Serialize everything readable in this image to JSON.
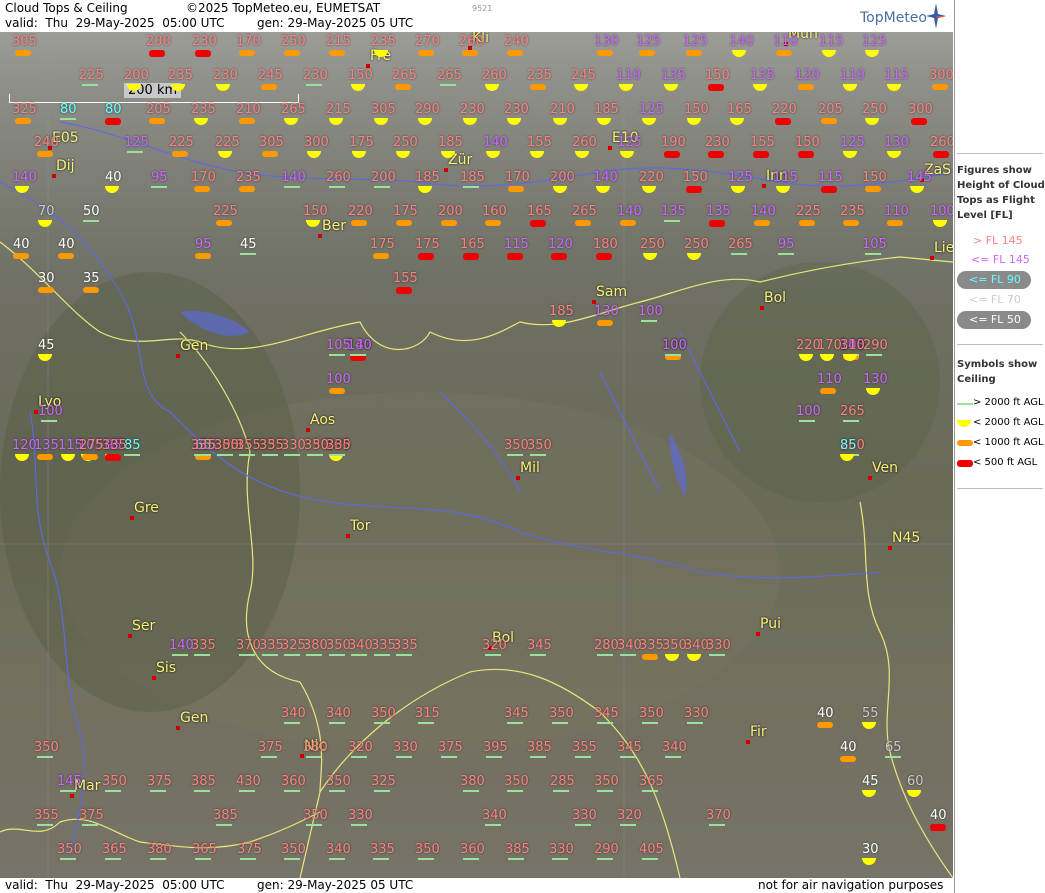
{
  "header": {
    "title": "Cloud Tops & Ceiling",
    "valid": "valid:  Thu  29-May-2025  05:00 UTC",
    "copyright": "©2025 TopMeteo.eu, EUMETSAT",
    "generated": "gen: 29-May-2025 05 UTC",
    "small_id": "9521",
    "logo": "TopMeteo"
  },
  "footer": {
    "valid": "valid:  Thu  29-May-2025  05:00 UTC",
    "generated": "gen: 29-May-2025 05 UTC",
    "note": "not for air navigation purposes"
  },
  "scale": {
    "label": "200 km"
  },
  "legend": {
    "figures_title": "Figures show Height of Cloud Tops as Flight Level [FL]",
    "levels": [
      {
        "label": "> FL 145",
        "color": "#ff8080"
      },
      {
        "label": "<= FL 145",
        "color": "#cc66ff"
      },
      {
        "label": "<= FL 90",
        "color": "#66ffff"
      },
      {
        "label": "<= FL 70",
        "color": "#cccccc"
      },
      {
        "label": "<= FL 50",
        "color": "#ffffff"
      }
    ],
    "symbols_title": "Symbols show Ceiling",
    "symbols": [
      {
        "label": "> 2000 ft AGL",
        "kind": "green-line"
      },
      {
        "label": "< 2000 ft AGL",
        "kind": "yellow-half"
      },
      {
        "label": "< 1000 ft AGL",
        "kind": "orange-pill"
      },
      {
        "label": "< 500 ft AGL",
        "kind": "red-pill"
      }
    ]
  },
  "cities": [
    "Fre",
    "Mun",
    "Kli",
    "Dij",
    "Zür",
    "Inn",
    "Ber",
    "Lie",
    "Sam",
    "Bol",
    "Gen",
    "Lyo",
    "Aos",
    "Mil",
    "Ven",
    "Gre",
    "Tor",
    "Ser",
    "Sis",
    "Gen",
    "Bol",
    "Pui",
    "Nic",
    "Fir",
    "Mar",
    "E05",
    "E10",
    "N45",
    "ZaS"
  ],
  "colors": {
    "high": "#ff8080",
    "mid": "#cc66ff",
    "fl90": "#66ffff",
    "fl70": "#cccccc",
    "fl50": "#ffffff",
    "city": "#f8f27a"
  },
  "stations": [
    [
      "305",
      "high",
      "orange"
    ],
    [
      "200",
      "high",
      "red"
    ],
    [
      "230",
      "high",
      "red"
    ],
    [
      "170",
      "high",
      "orange"
    ],
    [
      "250",
      "high",
      "orange"
    ],
    [
      "215",
      "high",
      "orange"
    ],
    [
      "235",
      "high",
      "yellow"
    ],
    [
      "270",
      "high",
      "orange"
    ],
    [
      "260",
      "high",
      "orange"
    ],
    [
      "240",
      "high",
      "orange"
    ],
    [
      "130",
      "mid",
      "orange"
    ],
    [
      "125",
      "mid",
      "orange"
    ],
    [
      "125",
      "mid",
      "orange"
    ],
    [
      "140",
      "mid",
      "yellow"
    ],
    [
      "110",
      "mid",
      "orange"
    ],
    [
      "115",
      "mid",
      "yellow"
    ],
    [
      "125",
      "mid",
      "yellow"
    ],
    [
      "225",
      "high",
      "green"
    ],
    [
      "200",
      "high",
      "yellow"
    ],
    [
      "235",
      "high",
      "yellow"
    ],
    [
      "230",
      "high",
      "yellow"
    ],
    [
      "245",
      "high",
      "orange"
    ],
    [
      "230",
      "high",
      "green"
    ],
    [
      "150",
      "high",
      "yellow"
    ],
    [
      "265",
      "high",
      "orange"
    ],
    [
      "265",
      "high",
      "green"
    ],
    [
      "260",
      "high",
      "yellow"
    ],
    [
      "235",
      "high",
      "orange"
    ],
    [
      "245",
      "high",
      "yellow"
    ],
    [
      "110",
      "mid",
      "yellow"
    ],
    [
      "135",
      "mid",
      "yellow"
    ],
    [
      "150",
      "high",
      "red"
    ],
    [
      "135",
      "mid",
      "yellow"
    ],
    [
      "120",
      "mid",
      "orange"
    ],
    [
      "110",
      "mid",
      "yellow"
    ],
    [
      "115",
      "mid",
      "yellow"
    ],
    [
      "300",
      "high",
      "orange"
    ],
    [
      "325",
      "high",
      "orange"
    ],
    [
      "80",
      "fl90",
      "green"
    ],
    [
      "80",
      "fl90",
      "red"
    ],
    [
      "205",
      "high",
      "orange"
    ],
    [
      "235",
      "high",
      "yellow"
    ],
    [
      "210",
      "high",
      "orange"
    ],
    [
      "265",
      "high",
      "yellow"
    ],
    [
      "215",
      "high",
      "yellow"
    ],
    [
      "305",
      "high",
      "yellow"
    ],
    [
      "290",
      "high",
      "yellow"
    ],
    [
      "230",
      "high",
      "yellow"
    ],
    [
      "230",
      "high",
      "yellow"
    ],
    [
      "210",
      "high",
      "yellow"
    ],
    [
      "185",
      "high",
      "yellow"
    ],
    [
      "125",
      "mid",
      "yellow"
    ],
    [
      "150",
      "high",
      "yellow"
    ],
    [
      "165",
      "high",
      "yellow"
    ],
    [
      "220",
      "high",
      "red"
    ],
    [
      "205",
      "high",
      "orange"
    ],
    [
      "250",
      "high",
      "yellow"
    ],
    [
      "300",
      "high",
      "red"
    ],
    [
      "240",
      "high",
      "orange"
    ],
    [
      "125",
      "mid",
      "green"
    ],
    [
      "225",
      "high",
      "orange"
    ],
    [
      "225",
      "high",
      "yellow"
    ],
    [
      "305",
      "high",
      "orange"
    ],
    [
      "300",
      "high",
      "yellow"
    ],
    [
      "175",
      "high",
      "yellow"
    ],
    [
      "250",
      "high",
      "yellow"
    ],
    [
      "185",
      "high",
      "yellow"
    ],
    [
      "140",
      "mid",
      "yellow"
    ],
    [
      "155",
      "high",
      "yellow"
    ],
    [
      "260",
      "high",
      "yellow"
    ],
    [
      "125",
      "mid",
      "yellow"
    ],
    [
      "190",
      "high",
      "red"
    ],
    [
      "230",
      "high",
      "red"
    ],
    [
      "155",
      "high",
      "red"
    ],
    [
      "150",
      "high",
      "red"
    ],
    [
      "125",
      "mid",
      "yellow"
    ],
    [
      "130",
      "mid",
      "yellow"
    ],
    [
      "260",
      "high",
      "red"
    ],
    [
      "140",
      "mid",
      "yellow"
    ],
    [
      "40",
      "fl50",
      "yellow"
    ],
    [
      "95",
      "mid",
      "green"
    ],
    [
      "170",
      "high",
      "orange"
    ],
    [
      "235",
      "high",
      "orange"
    ],
    [
      "140",
      "mid",
      "green"
    ],
    [
      "260",
      "high",
      "green"
    ],
    [
      "200",
      "high",
      "green"
    ],
    [
      "185",
      "high",
      "yellow"
    ],
    [
      "185",
      "high",
      "green"
    ],
    [
      "170",
      "high",
      "orange"
    ],
    [
      "200",
      "high",
      "yellow"
    ],
    [
      "140",
      "mid",
      "yellow"
    ],
    [
      "220",
      "high",
      "yellow"
    ],
    [
      "150",
      "high",
      "red"
    ],
    [
      "125",
      "mid",
      "yellow"
    ],
    [
      "115",
      "mid",
      "yellow"
    ],
    [
      "115",
      "mid",
      "red"
    ],
    [
      "150",
      "high",
      "orange"
    ],
    [
      "145",
      "mid",
      "yellow"
    ],
    [
      "70",
      "fl70",
      "yellow"
    ],
    [
      "50",
      "fl50",
      "green"
    ],
    [
      "225",
      "high",
      "orange"
    ],
    [
      "150",
      "high",
      "yellow"
    ],
    [
      "220",
      "high",
      "orange"
    ],
    [
      "175",
      "high",
      "orange"
    ],
    [
      "200",
      "high",
      "orange"
    ],
    [
      "160",
      "high",
      "orange"
    ],
    [
      "165",
      "high",
      "red"
    ],
    [
      "265",
      "high",
      "orange"
    ],
    [
      "140",
      "mid",
      "orange"
    ],
    [
      "135",
      "mid",
      "green"
    ],
    [
      "135",
      "mid",
      "red"
    ],
    [
      "140",
      "mid",
      "orange"
    ],
    [
      "225",
      "high",
      "orange"
    ],
    [
      "235",
      "high",
      "orange"
    ],
    [
      "110",
      "mid",
      "orange"
    ],
    [
      "100",
      "mid",
      "yellow"
    ],
    [
      "40",
      "fl50",
      "orange"
    ],
    [
      "40",
      "fl50",
      "orange"
    ],
    [
      "95",
      "mid",
      "orange"
    ],
    [
      "45",
      "fl50",
      "green"
    ],
    [
      "175",
      "high",
      "orange"
    ],
    [
      "175",
      "high",
      "red"
    ],
    [
      "165",
      "high",
      "red"
    ],
    [
      "115",
      "mid",
      "red"
    ],
    [
      "120",
      "mid",
      "red"
    ],
    [
      "180",
      "high",
      "red"
    ],
    [
      "250",
      "high",
      "yellow"
    ],
    [
      "250",
      "high",
      "yellow"
    ],
    [
      "265",
      "high",
      "green"
    ],
    [
      "95",
      "mid",
      "green"
    ],
    [
      "105",
      "mid",
      "green"
    ],
    [
      "30",
      "fl50",
      "orange"
    ],
    [
      "35",
      "fl50",
      "orange"
    ],
    [
      "155",
      "high",
      "red"
    ],
    [
      "130",
      "mid",
      "red"
    ],
    [
      "100",
      "mid",
      "orange"
    ],
    [
      "105",
      "mid",
      "orange"
    ],
    [
      "100",
      "mid",
      "orange"
    ],
    [
      "110",
      "mid",
      "orange"
    ],
    [
      "130",
      "mid",
      "yellow"
    ],
    [
      "100",
      "mid",
      "green"
    ],
    [
      "100",
      "mid",
      "green"
    ],
    [
      "265",
      "high",
      "green"
    ],
    [
      "185",
      "high",
      "yellow"
    ],
    [
      "130",
      "mid",
      "orange"
    ],
    [
      "100",
      "mid",
      "green"
    ],
    [
      "140",
      "mid",
      "green"
    ],
    [
      "100",
      "mid",
      "green"
    ],
    [
      "140",
      "mid",
      "green"
    ],
    [
      "105",
      "mid",
      "green"
    ],
    [
      "170",
      "high",
      "yellow"
    ],
    [
      "290",
      "high",
      "green"
    ],
    [
      "45",
      "fl50",
      "yellow"
    ],
    [
      "220",
      "high",
      "yellow"
    ],
    [
      "310",
      "high",
      "yellow"
    ],
    [
      "120",
      "mid",
      "yellow"
    ],
    [
      "95",
      "mid",
      "yellow"
    ],
    [
      "65",
      "fl70",
      "green"
    ],
    [
      "200",
      "high",
      "yellow"
    ],
    [
      "335",
      "high",
      "green"
    ],
    [
      "135",
      "mid",
      "orange"
    ],
    [
      "105",
      "mid",
      "yellow"
    ],
    [
      "115",
      "mid",
      "yellow"
    ],
    [
      "105",
      "mid",
      "orange"
    ],
    [
      "115",
      "mid",
      "orange"
    ],
    [
      "155",
      "high",
      "green"
    ],
    [
      "275",
      "high",
      "orange"
    ],
    [
      "85",
      "fl90",
      "green"
    ],
    [
      "305",
      "high",
      "green"
    ],
    [
      "335",
      "high",
      "green"
    ],
    [
      "330",
      "high",
      "green"
    ],
    [
      "260",
      "high",
      "green"
    ],
    [
      "335",
      "high",
      "red"
    ],
    [
      "335",
      "high",
      "green"
    ],
    [
      "355",
      "high",
      "green"
    ],
    [
      "330",
      "high",
      "green"
    ],
    [
      "335",
      "high",
      "green"
    ],
    [
      "350",
      "high",
      "green"
    ],
    [
      "350",
      "high",
      "green"
    ],
    [
      "355",
      "high",
      "green"
    ],
    [
      "350",
      "high",
      "green"
    ],
    [
      "350",
      "high",
      "green"
    ],
    [
      "85",
      "fl90",
      "yellow"
    ],
    [
      "335",
      "high",
      "green"
    ],
    [
      "370",
      "high",
      "green"
    ],
    [
      "325",
      "high",
      "green"
    ],
    [
      "350",
      "high",
      "green"
    ],
    [
      "335",
      "high",
      "green"
    ],
    [
      "280",
      "high",
      "green"
    ],
    [
      "335",
      "high",
      "orange"
    ],
    [
      "340",
      "high",
      "yellow"
    ],
    [
      "140",
      "mid",
      "green"
    ],
    [
      "335",
      "high",
      "green"
    ],
    [
      "380",
      "high",
      "green"
    ],
    [
      "340",
      "high",
      "green"
    ],
    [
      "335",
      "high",
      "green"
    ],
    [
      "320",
      "high",
      "green"
    ],
    [
      "345",
      "high",
      "green"
    ],
    [
      "340",
      "high",
      "green"
    ],
    [
      "350",
      "high",
      "yellow"
    ],
    [
      "330",
      "high",
      "green"
    ],
    [
      "340",
      "high",
      "green"
    ],
    [
      "340",
      "high",
      "green"
    ],
    [
      "350",
      "high",
      "green"
    ],
    [
      "315",
      "high",
      "green"
    ],
    [
      "345",
      "high",
      "green"
    ],
    [
      "350",
      "high",
      "green"
    ],
    [
      "345",
      "high",
      "green"
    ],
    [
      "350",
      "high",
      "green"
    ],
    [
      "330",
      "high",
      "green"
    ],
    [
      "40",
      "fl50",
      "orange"
    ],
    [
      "55",
      "fl70",
      "yellow"
    ],
    [
      "350",
      "high",
      "green"
    ],
    [
      "375",
      "high",
      "green"
    ],
    [
      "380",
      "high",
      "green"
    ],
    [
      "320",
      "high",
      "green"
    ],
    [
      "330",
      "high",
      "green"
    ],
    [
      "375",
      "high",
      "green"
    ],
    [
      "395",
      "high",
      "green"
    ],
    [
      "385",
      "high",
      "green"
    ],
    [
      "355",
      "high",
      "green"
    ],
    [
      "345",
      "high",
      "green"
    ],
    [
      "340",
      "high",
      "green"
    ],
    [
      "40",
      "fl50",
      "orange"
    ],
    [
      "65",
      "fl70",
      "green"
    ],
    [
      "145",
      "mid",
      "green"
    ],
    [
      "350",
      "high",
      "green"
    ],
    [
      "375",
      "high",
      "green"
    ],
    [
      "385",
      "high",
      "green"
    ],
    [
      "430",
      "high",
      "green"
    ],
    [
      "360",
      "high",
      "green"
    ],
    [
      "350",
      "high",
      "green"
    ],
    [
      "325",
      "high",
      "green"
    ],
    [
      "380",
      "high",
      "green"
    ],
    [
      "350",
      "high",
      "green"
    ],
    [
      "285",
      "high",
      "green"
    ],
    [
      "350",
      "high",
      "green"
    ],
    [
      "365",
      "high",
      "green"
    ],
    [
      "45",
      "fl50",
      "yellow"
    ],
    [
      "60",
      "fl70",
      "yellow"
    ],
    [
      "355",
      "high",
      "green"
    ],
    [
      "375",
      "high",
      "green"
    ],
    [
      "385",
      "high",
      "green"
    ],
    [
      "350",
      "high",
      "green"
    ],
    [
      "330",
      "high",
      "green"
    ],
    [
      "340",
      "high",
      "green"
    ],
    [
      "330",
      "high",
      "green"
    ],
    [
      "320",
      "high",
      "green"
    ],
    [
      "370",
      "high",
      "green"
    ],
    [
      "40",
      "fl50",
      "red"
    ],
    [
      "350",
      "high",
      "green"
    ],
    [
      "365",
      "high",
      "green"
    ],
    [
      "380",
      "high",
      "green"
    ],
    [
      "365",
      "high",
      "green"
    ],
    [
      "375",
      "high",
      "green"
    ],
    [
      "350",
      "high",
      "green"
    ],
    [
      "340",
      "high",
      "green"
    ],
    [
      "335",
      "high",
      "green"
    ],
    [
      "350",
      "high",
      "green"
    ],
    [
      "360",
      "high",
      "green"
    ],
    [
      "385",
      "high",
      "green"
    ],
    [
      "330",
      "high",
      "green"
    ],
    [
      "290",
      "high",
      "green"
    ],
    [
      "405",
      "high",
      "green"
    ],
    [
      "30",
      "fl50",
      "yellow"
    ]
  ]
}
